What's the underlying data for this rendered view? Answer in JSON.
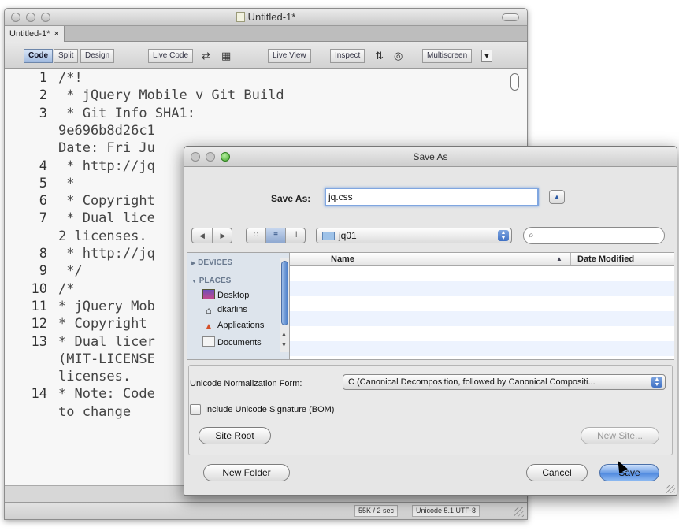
{
  "editor": {
    "window_title": "Untitled-1*",
    "tab_label": "Untitled-1*",
    "tab_close": "×",
    "toolbar": {
      "code": "Code",
      "split": "Split",
      "design": "Design",
      "live_code": "Live Code",
      "live_view": "Live View",
      "inspect": "Inspect",
      "multiscreen": "Multiscreen"
    },
    "code_lines": [
      {
        "num": "1",
        "text": "/*!"
      },
      {
        "num": "2",
        "text": " * jQuery Mobile v Git Build"
      },
      {
        "num": "3",
        "text": " * Git Info SHA1:"
      },
      {
        "num": "",
        "text": "9e696b8d26c1"
      },
      {
        "num": "",
        "text": "Date: Fri Ju"
      },
      {
        "num": "4",
        "text": " * http://jq"
      },
      {
        "num": "5",
        "text": " *"
      },
      {
        "num": "6",
        "text": " * Copyright"
      },
      {
        "num": "7",
        "text": " * Dual lice"
      },
      {
        "num": "",
        "text": "2 licenses."
      },
      {
        "num": "8",
        "text": " * http://jq"
      },
      {
        "num": "9",
        "text": " */"
      },
      {
        "num": "10",
        "text": "/*"
      },
      {
        "num": "11",
        "text": "* jQuery Mob"
      },
      {
        "num": "12",
        "text": "* Copyright"
      },
      {
        "num": "13",
        "text": "* Dual licer"
      },
      {
        "num": "",
        "text": "(MIT-LICENSE"
      },
      {
        "num": "",
        "text": "licenses."
      },
      {
        "num": "14",
        "text": "* Note: Code"
      },
      {
        "num": "",
        "text": "to change"
      }
    ],
    "column_marker": "01",
    "status": {
      "size": "55K / 2 sec",
      "encoding": "Unicode 5.1 UTF-8"
    }
  },
  "save_dialog": {
    "title": "Save As",
    "save_as_label": "Save As:",
    "filename": "jq.css",
    "folder": "jq01",
    "search_placeholder": "",
    "sidebar": {
      "devices_header": "DEVICES",
      "places_header": "PLACES",
      "items": [
        "Desktop",
        "dkarlins",
        "Applications",
        "Documents"
      ]
    },
    "columns": {
      "name": "Name",
      "date": "Date Modified"
    },
    "unicode_label": "Unicode Normalization Form:",
    "unicode_value": "C (Canonical Decomposition, followed by Canonical Compositi...",
    "bom_label": "Include Unicode Signature (BOM)",
    "site_root": "Site Root",
    "new_site": "New Site...",
    "new_folder": "New Folder",
    "cancel": "Cancel",
    "save": "Save"
  },
  "colors": {
    "accent_blue": "#4c86dd",
    "focus_ring": "#7fa6e0",
    "sidebar_bg": "#dde4ec"
  }
}
